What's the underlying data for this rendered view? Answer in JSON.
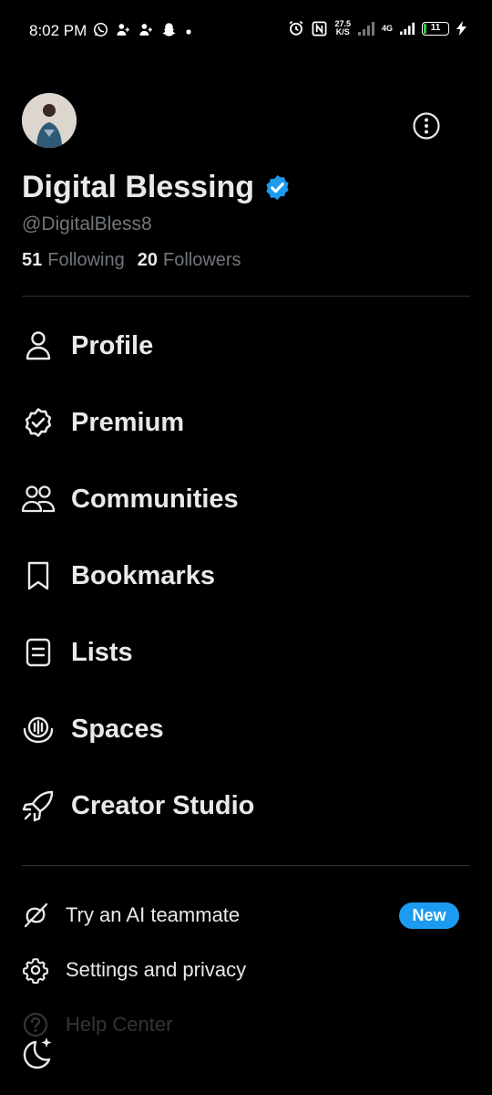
{
  "status_bar": {
    "time": "8:02 PM",
    "speed_value": "27.5",
    "speed_unit": "K/S",
    "network": "4G",
    "battery_level": "11"
  },
  "profile": {
    "display_name": "Digital Blessing",
    "handle": "@DigitalBless8",
    "following_count": "51",
    "following_label": "Following",
    "followers_count": "20",
    "followers_label": "Followers"
  },
  "menu": {
    "items": [
      {
        "label": "Profile",
        "icon": "person-icon"
      },
      {
        "label": "Premium",
        "icon": "verified-badge-outline-icon"
      },
      {
        "label": "Communities",
        "icon": "people-icon"
      },
      {
        "label": "Bookmarks",
        "icon": "bookmark-icon"
      },
      {
        "label": "Lists",
        "icon": "list-icon"
      },
      {
        "label": "Spaces",
        "icon": "microphone-icon"
      },
      {
        "label": "Creator Studio",
        "icon": "rocket-icon"
      }
    ]
  },
  "secondary": {
    "ai": {
      "label": "Try an AI teammate",
      "badge": "New",
      "icon": "grok-icon"
    },
    "settings": {
      "label": "Settings and privacy",
      "icon": "gear-icon"
    },
    "help": {
      "label": "Help Center",
      "icon": "help-icon"
    }
  },
  "colors": {
    "background": "#000000",
    "text": "#e7e9ea",
    "muted": "#71767b",
    "accent": "#1d9bf0",
    "divider": "#2f3336"
  }
}
